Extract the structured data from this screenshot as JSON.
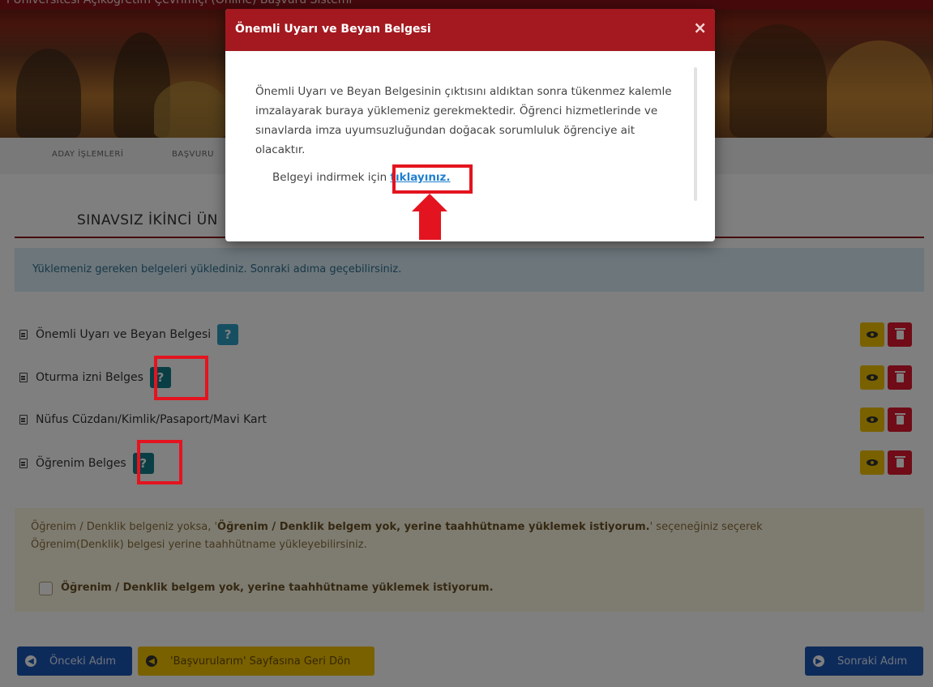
{
  "header": {
    "title": "ı Üniversitesi Açıköğretim Çevrimiçi (Online) Başvuru Sistemi"
  },
  "nav": {
    "items": [
      "ADAY İŞLEMLERİ",
      "BAŞVURU"
    ]
  },
  "page": {
    "title": "SINAVSIZ İKİNCİ ÜN",
    "info_message": "Yüklemeniz gereken belgeleri yüklediniz. Sonraki adıma geçebilirsiniz."
  },
  "documents": [
    {
      "label": "Önemli Uyarı ve Beyan Belgesi",
      "help": "?"
    },
    {
      "label": "Oturma izni Belges",
      "help": "?"
    },
    {
      "label": "Nüfus Cüzdanı/Kimlik/Pasaport/Mavi Kart"
    },
    {
      "label": "Öğrenim Belges",
      "help": "?"
    }
  ],
  "warning": {
    "line1_prefix": "Öğrenim / Denklik belgeniz yoksa, '",
    "line1_bold": "Öğrenim / Denklik belgem yok, yerine taahhütname yüklemek istiyorum.",
    "line1_suffix": "' seçeneğiniz seçerek",
    "line2": "Öğrenim(Denklik) belgesi yerine taahhütname yükleyebilirsiniz.",
    "checkbox_label": "Öğrenim / Denklik belgem yok, yerine taahhütname yüklemek istiyorum."
  },
  "buttons": {
    "prev": "Önceki Adım",
    "back": "'Başvurularım' Sayfasına Geri Dön",
    "next": "Sonraki Adım"
  },
  "modal": {
    "title": "Önemli Uyarı ve Beyan Belgesi",
    "close": "×",
    "body": "Önemli Uyarı ve Beyan Belgesinin çıktısını aldıktan sonra tükenmez kalemle imzalayarak buraya yüklemeniz gerekmektedir. Öğrenci hizmetlerinde ve sınavlarda imza uyumsuzluğundan doğacak sorumluluk öğrenciye ait olacaktır.",
    "download_prefix": "Belgeyi indirmek için",
    "download_link": "tıklayınız."
  },
  "colors": {
    "accent": "#a3191f",
    "primary": "#1b56b4",
    "warning": "#f3c200",
    "danger": "#e0192e",
    "annotation": "#e3141f"
  }
}
